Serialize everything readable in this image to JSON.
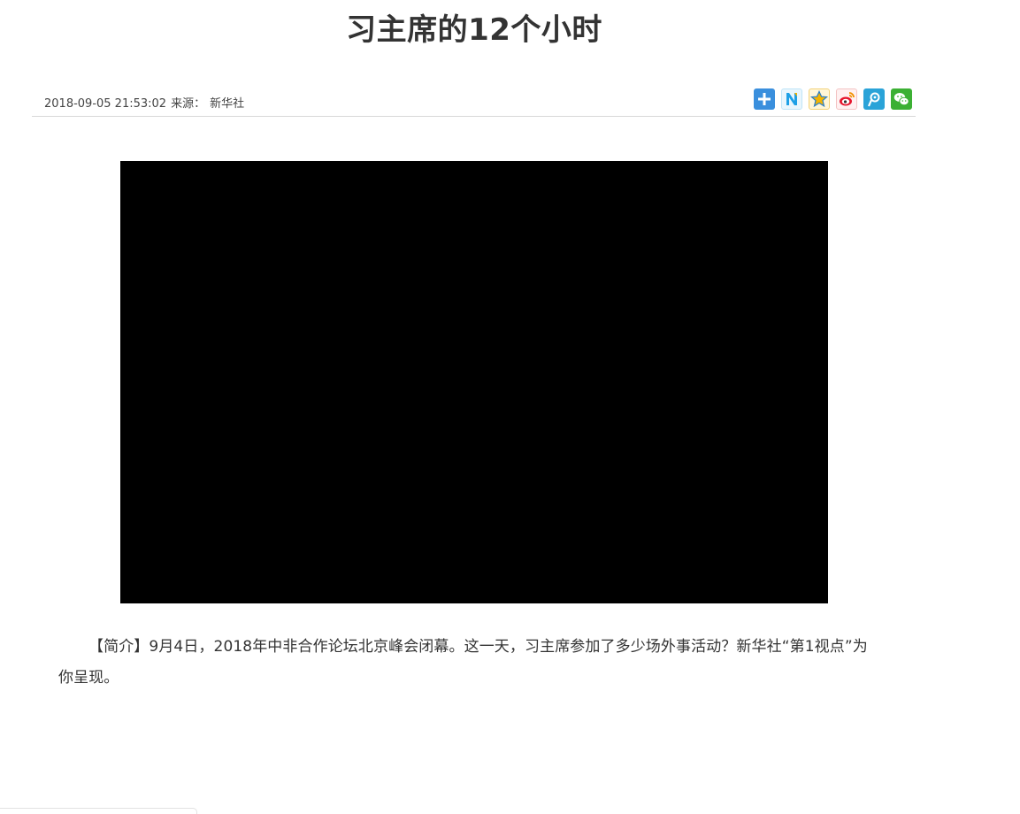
{
  "article": {
    "title": "习主席的12个小时",
    "datetime": "2018-09-05 21:53:02",
    "source_label": "来源：",
    "source": "新华社",
    "intro": "【简介】9月4日，2018年中非合作论坛北京峰会闭幕。这一天，习主席参加了多少场外事活动？新华社“第1视点”为你呈现。"
  },
  "share": {
    "icons": [
      "share-more-icon",
      "share-n-icon",
      "share-qzone-icon",
      "share-weibo-icon",
      "share-tencent-weibo-icon",
      "share-wechat-icon"
    ],
    "colors": {
      "more": "#3a8fdd",
      "n": "#1ea0e6",
      "qzone": "#f5b400",
      "weibo": "#e6162d",
      "tencent": "#2aa3d8",
      "wechat": "#3cb034"
    }
  },
  "video": {
    "background": "#000000"
  }
}
